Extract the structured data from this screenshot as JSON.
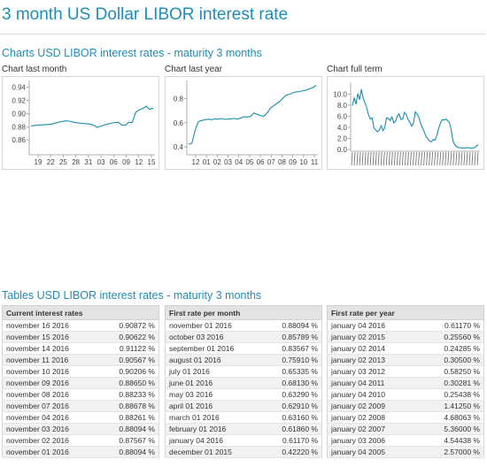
{
  "page": {
    "title": "3 month US Dollar LIBOR interest rate"
  },
  "charts_section": {
    "title": "Charts USD LIBOR interest rates - maturity 3 months",
    "charts": [
      {
        "caption": "Chart last month"
      },
      {
        "caption": "Chart last year"
      },
      {
        "caption": "Chart full term"
      }
    ]
  },
  "chart_data": [
    {
      "type": "line",
      "title": "Chart last month",
      "ylim": [
        0.84,
        0.945
      ],
      "yticks": [
        "0.94",
        "0.92",
        "0.90",
        "0.88",
        "0.86"
      ],
      "xticks": [
        "19",
        "22",
        "25",
        "28",
        "31",
        "03",
        "06",
        "09",
        "12",
        "15"
      ],
      "color": "#1a8cae",
      "values": [
        0.881,
        0.882,
        0.8825,
        0.8828,
        0.8832,
        0.8835,
        0.884,
        0.8855,
        0.887,
        0.888,
        0.889,
        0.8885,
        0.887,
        0.8862,
        0.8855,
        0.885,
        0.8845,
        0.884,
        0.882,
        0.879,
        0.8809,
        0.8825,
        0.884,
        0.8852,
        0.8865,
        0.8868,
        0.8826,
        0.8823,
        0.8868,
        0.8865,
        0.9021,
        0.9057,
        0.9079,
        0.9112,
        0.9062,
        0.9087
      ]
    },
    {
      "type": "line",
      "title": "Chart last year",
      "ylim": [
        0.35,
        0.92
      ],
      "yticks": [
        "0.8",
        "0.6",
        "0.4"
      ],
      "xticks": [
        "12",
        "01",
        "02",
        "03",
        "04",
        "05",
        "06",
        "07",
        "08",
        "09",
        "10",
        "11"
      ],
      "color": "#1a8cae",
      "values": [
        0.4222,
        0.43,
        0.54,
        0.61,
        0.6186,
        0.625,
        0.63,
        0.625,
        0.6316,
        0.63,
        0.635,
        0.6291,
        0.63,
        0.6329,
        0.635,
        0.63,
        0.64,
        0.65,
        0.647,
        0.654,
        0.6813,
        0.67,
        0.66,
        0.6534,
        0.68,
        0.72,
        0.74,
        0.7591,
        0.78,
        0.81,
        0.83,
        0.8357,
        0.85,
        0.855,
        0.8579,
        0.865,
        0.87,
        0.8809,
        0.89,
        0.9087
      ]
    },
    {
      "type": "line",
      "title": "Chart full term",
      "ylim": [
        0,
        11.5
      ],
      "yticks": [
        "10.0",
        "8.0",
        "6.0",
        "4.0",
        "2.0",
        "0.0"
      ],
      "color": "#1a8cae",
      "values": [
        7.9,
        9.3,
        8.2,
        10.1,
        9.0,
        10.9,
        9.2,
        8.4,
        7.5,
        6.2,
        5.5,
        5.7,
        3.9,
        3.5,
        3.2,
        3.5,
        4.3,
        3.4,
        3.9,
        5.7,
        5.6,
        5.2,
        5.9,
        4.8,
        5.1,
        6.0,
        6.4,
        5.4,
        5.5,
        6.7,
        6.3,
        5.4,
        4.9,
        4.2,
        4.8,
        6.8,
        6.4,
        5.8,
        4.7,
        3.9,
        3.2,
        2.3,
        1.9,
        1.5,
        1.4,
        1.8,
        1.7,
        2.5,
        3.8,
        4.7,
        5.4,
        5.3,
        5.5,
        5.2,
        4.9,
        3.5,
        1.5,
        0.9,
        0.5,
        0.35,
        0.3,
        0.27,
        0.26,
        0.3,
        0.3,
        0.28,
        0.25,
        0.24,
        0.32,
        0.61,
        0.9
      ]
    }
  ],
  "tables_section": {
    "title": "Tables USD LIBOR interest rates - maturity 3 months",
    "tables": [
      {
        "header": "Current interest rates",
        "rows": [
          [
            "november 16 2016",
            "0.90872 %"
          ],
          [
            "november 15 2016",
            "0.90622 %"
          ],
          [
            "november 14 2016",
            "0.91122 %"
          ],
          [
            "november 11 2016",
            "0.90567 %"
          ],
          [
            "november 10 2016",
            "0.90206 %"
          ],
          [
            "november 09 2016",
            "0.88650 %"
          ],
          [
            "november 08 2016",
            "0.88233 %"
          ],
          [
            "november 07 2016",
            "0.88678 %"
          ],
          [
            "november 04 2016",
            "0.88261 %"
          ],
          [
            "november 03 2016",
            "0.88094 %"
          ],
          [
            "november 02 2016",
            "0.87567 %"
          ],
          [
            "november 01 2016",
            "0.88094 %"
          ]
        ]
      },
      {
        "header": "First rate per month",
        "rows": [
          [
            "november 01 2016",
            "0.88094 %"
          ],
          [
            "october 03 2016",
            "0.85789 %"
          ],
          [
            "september 01 2016",
            "0.83567 %"
          ],
          [
            "august 01 2016",
            "0.75910 %"
          ],
          [
            "july 01 2016",
            "0.65335 %"
          ],
          [
            "june 01 2016",
            "0.68130 %"
          ],
          [
            "may 03 2016",
            "0.63290 %"
          ],
          [
            "april 01 2016",
            "0.62910 %"
          ],
          [
            "march 01 2016",
            "0.63160 %"
          ],
          [
            "february 01 2016",
            "0.61860 %"
          ],
          [
            "january 04 2016",
            "0.61170 %"
          ],
          [
            "december 01 2015",
            "0.42220 %"
          ]
        ]
      },
      {
        "header": "First rate per year",
        "rows": [
          [
            "january 04 2016",
            "0.61170 %"
          ],
          [
            "january 02 2015",
            "0.25560 %"
          ],
          [
            "january 02 2014",
            "0.24285 %"
          ],
          [
            "january 02 2013",
            "0.30500 %"
          ],
          [
            "january 03 2012",
            "0.58250 %"
          ],
          [
            "january 04 2011",
            "0.30281 %"
          ],
          [
            "january 04 2010",
            "0.25438 %"
          ],
          [
            "january 02 2009",
            "1.41250 %"
          ],
          [
            "january 02 2008",
            "4.68063 %"
          ],
          [
            "january 02 2007",
            "5.36000 %"
          ],
          [
            "january 03 2006",
            "4.54438 %"
          ],
          [
            "january 04 2005",
            "2.57000 %"
          ]
        ]
      }
    ]
  }
}
